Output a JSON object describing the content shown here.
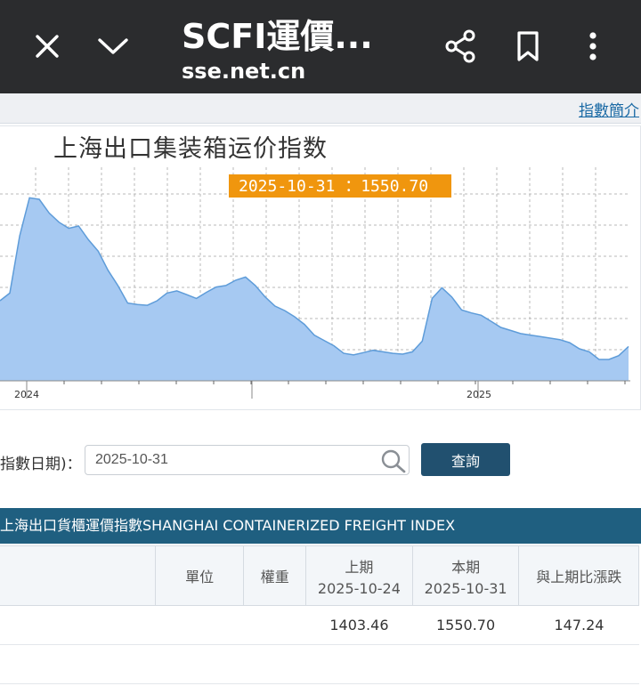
{
  "browser": {
    "title": "SCFI運價...",
    "url": "sse.net.cn",
    "icons": [
      "close-icon",
      "chevron-down-icon",
      "share-icon",
      "bookmark-icon",
      "more-vert-icon"
    ]
  },
  "page": {
    "intro_link": "指數簡介",
    "chart": {
      "title": "上海出口集装箱运价指数",
      "tooltip": "2025-10-31 ：1550.70",
      "tooltip_color": "#f0960e",
      "fill_color": "#a6c9f2",
      "line_color": "#5e9cd9",
      "x_labels": [
        "2024",
        "2025"
      ]
    },
    "search": {
      "label": "指數日期)：",
      "date_value": "2025-10-31",
      "button": "查詢"
    },
    "table": {
      "caption": "上海出口貨櫃運價指數SHANGHAI CONTAINERIZED FREIGHT INDEX",
      "headers": {
        "unit": "單位",
        "weight": "權重",
        "prev_label": "上期",
        "prev_date": "2025-10-24",
        "curr_label": "本期",
        "curr_date": "2025-10-31",
        "change": "與上期比漲跌"
      },
      "row": {
        "prev": "1403.46",
        "curr": "1550.70",
        "change": "147.24"
      }
    }
  },
  "chart_data": {
    "type": "area",
    "title": "上海出口集装箱运价指数",
    "x_labels": [
      "2024",
      "2025"
    ],
    "highlight": {
      "date": "2025-10-31",
      "value": 1550.7
    },
    "series": [
      {
        "values": [
          2150,
          2250,
          3000,
          3500,
          3480,
          3300,
          3180,
          3100,
          3130,
          2950,
          2800,
          2550,
          2350,
          2120,
          2100,
          2090,
          2150,
          2250,
          2280,
          2230,
          2180,
          2260,
          2330,
          2350,
          2420,
          2460,
          2350,
          2200,
          2080,
          2020,
          1940,
          1840,
          1700,
          1630,
          1560,
          1460,
          1440,
          1470,
          1500,
          1480,
          1460,
          1450,
          1480,
          1620,
          2180,
          2320,
          2200,
          2030,
          1990,
          1960,
          1880,
          1800,
          1760,
          1720,
          1700,
          1680,
          1660,
          1640,
          1600,
          1520,
          1480,
          1380,
          1380,
          1430,
          1550
        ]
      }
    ]
  }
}
